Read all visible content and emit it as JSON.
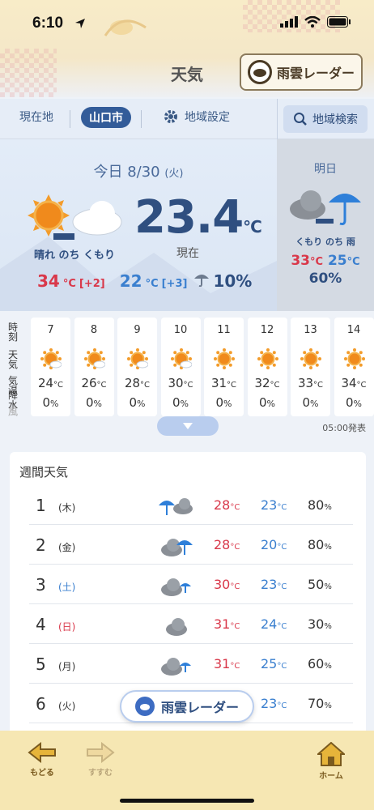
{
  "status": {
    "time": "6:10"
  },
  "header": {
    "title": "天気",
    "radar_label": "雨雲レーダー"
  },
  "tabs": {
    "current": "現在地",
    "city": "山口市",
    "setting": "地域設定",
    "search": "地域検索"
  },
  "today": {
    "date": "今日 8/30",
    "weekday": "(火)",
    "weather": "晴れ のち くもり",
    "temp_now": "23.4",
    "unit": "°C",
    "now_label": "現在",
    "high": "34",
    "high_diff": "[+2]",
    "low": "22",
    "low_diff": "[+3]",
    "rain": "10%"
  },
  "tomorrow": {
    "title": "明日",
    "weather": "くもり のち 雨",
    "high": "33",
    "low": "25",
    "rain": "60%"
  },
  "hourly": {
    "labels": [
      "時刻",
      "天気",
      "気温",
      "降水",
      "風"
    ],
    "hours": [
      {
        "hour": "7",
        "icon": "sun-cloud-icon",
        "temp": "24",
        "precip": "0"
      },
      {
        "hour": "8",
        "icon": "sun-cloud-icon",
        "temp": "26",
        "precip": "0"
      },
      {
        "hour": "9",
        "icon": "sun-cloud-icon",
        "temp": "28",
        "precip": "0"
      },
      {
        "hour": "10",
        "icon": "sun-cloud-icon",
        "temp": "30",
        "precip": "0"
      },
      {
        "hour": "11",
        "icon": "sun-icon",
        "temp": "31",
        "precip": "0"
      },
      {
        "hour": "12",
        "icon": "sun-icon",
        "temp": "32",
        "precip": "0"
      },
      {
        "hour": "13",
        "icon": "sun-icon",
        "temp": "33",
        "precip": "0"
      },
      {
        "hour": "14",
        "icon": "sun-icon",
        "temp": "34",
        "precip": "0"
      }
    ],
    "issued": "05:00発表",
    "temp_unit": "°C",
    "pct_unit": "%"
  },
  "weekly": {
    "title": "週間天気",
    "days": [
      {
        "day": "1",
        "wd": "(木)",
        "wd_color": "#333333",
        "icon": "rain-cloud-icon",
        "high": "28",
        "low": "23",
        "rain": "80"
      },
      {
        "day": "2",
        "wd": "(金)",
        "wd_color": "#333333",
        "icon": "cloud-rain-icon",
        "high": "28",
        "low": "20",
        "rain": "80"
      },
      {
        "day": "3",
        "wd": "(土)",
        "wd_color": "#3a7fcf",
        "icon": "cloud-rain-small-icon",
        "high": "30",
        "low": "23",
        "rain": "50"
      },
      {
        "day": "4",
        "wd": "(日)",
        "wd_color": "#d9384a",
        "icon": "cloud-icon",
        "high": "31",
        "low": "24",
        "rain": "30"
      },
      {
        "day": "5",
        "wd": "(月)",
        "wd_color": "#333333",
        "icon": "cloud-rain-small-icon",
        "high": "31",
        "low": "25",
        "rain": "60"
      },
      {
        "day": "6",
        "wd": "(火)",
        "wd_color": "#333333",
        "icon": "cloud-icon",
        "high": "",
        "low": "23",
        "rain": "70"
      }
    ]
  },
  "float_radar": {
    "label": "雨雲レーダー"
  },
  "bottom": {
    "back": "もどる",
    "forward": "すすむ",
    "home": "ホーム"
  }
}
